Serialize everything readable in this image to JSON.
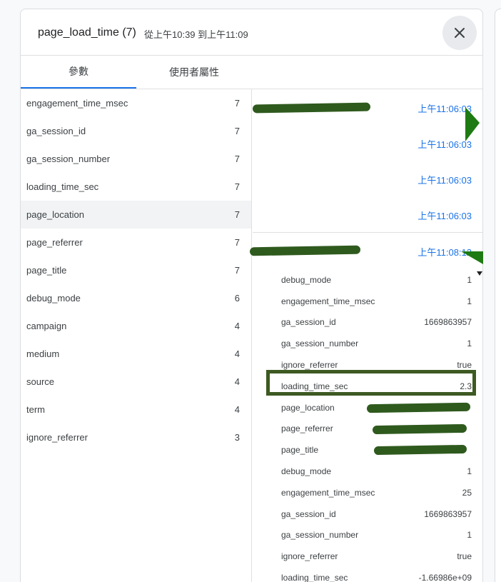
{
  "header": {
    "title": "page_load_time (7)",
    "range": "從上午10:39 到上午11:09"
  },
  "tabs": [
    {
      "label": "參數"
    },
    {
      "label": "使用者屬性"
    }
  ],
  "params": [
    {
      "name": "engagement_time_msec",
      "count": "7"
    },
    {
      "name": "ga_session_id",
      "count": "7"
    },
    {
      "name": "ga_session_number",
      "count": "7"
    },
    {
      "name": "loading_time_sec",
      "count": "7"
    },
    {
      "name": "page_location",
      "count": "7"
    },
    {
      "name": "page_referrer",
      "count": "7"
    },
    {
      "name": "page_title",
      "count": "7"
    },
    {
      "name": "debug_mode",
      "count": "6"
    },
    {
      "name": "campaign",
      "count": "4"
    },
    {
      "name": "medium",
      "count": "4"
    },
    {
      "name": "source",
      "count": "4"
    },
    {
      "name": "term",
      "count": "4"
    },
    {
      "name": "ignore_referrer",
      "count": "3"
    }
  ],
  "events": [
    {
      "time": "上午11:06:03"
    },
    {
      "time": "上午11:06:03"
    },
    {
      "time": "上午11:06:03"
    },
    {
      "time": "上午11:06:03"
    },
    {
      "time": "上午11:08:12"
    }
  ],
  "event_params": [
    {
      "key": "debug_mode",
      "value": "1"
    },
    {
      "key": "engagement_time_msec",
      "value": "1"
    },
    {
      "key": "ga_session_id",
      "value": "1669863957"
    },
    {
      "key": "ga_session_number",
      "value": "1"
    },
    {
      "key": "ignore_referrer",
      "value": "true"
    },
    {
      "key": "loading_time_sec",
      "value": "2.3"
    },
    {
      "key": "page_location",
      "value": ""
    },
    {
      "key": "page_referrer",
      "value": ""
    },
    {
      "key": "page_title",
      "value": ""
    },
    {
      "key": "debug_mode",
      "value": "1"
    },
    {
      "key": "engagement_time_msec",
      "value": "25"
    },
    {
      "key": "ga_session_id",
      "value": "1669863957"
    },
    {
      "key": "ga_session_number",
      "value": "1"
    },
    {
      "key": "ignore_referrer",
      "value": "true"
    },
    {
      "key": "loading_time_sec",
      "value": "-1.66986e+09"
    }
  ],
  "colors": {
    "accent": "#1a73e8",
    "annotation": "#3d5a22",
    "marker": "#1e7a12"
  }
}
